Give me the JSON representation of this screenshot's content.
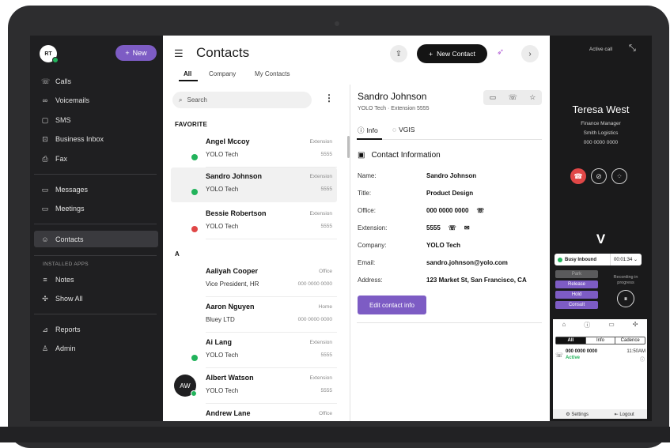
{
  "sidebar": {
    "avatar": "RT",
    "new_label": "New",
    "items": [
      {
        "label": "Calls",
        "icon": "phone-icon"
      },
      {
        "label": "Voicemails",
        "icon": "voicemail-icon"
      },
      {
        "label": "SMS",
        "icon": "sms-icon"
      },
      {
        "label": "Business Inbox",
        "icon": "inbox-icon"
      },
      {
        "label": "Fax",
        "icon": "fax-icon"
      },
      {
        "label": "Messages",
        "icon": "messages-icon"
      },
      {
        "label": "Meetings",
        "icon": "video-icon"
      },
      {
        "label": "Contacts",
        "icon": "contacts-icon"
      }
    ],
    "installed_caption": "INSTALLED APPS",
    "apps": [
      {
        "label": "Notes",
        "icon": "notes-icon"
      },
      {
        "label": "Show All",
        "icon": "puzzle-icon"
      }
    ],
    "bottom": [
      {
        "label": "Reports",
        "icon": "reports-icon"
      },
      {
        "label": "Admin",
        "icon": "admin-icon"
      }
    ]
  },
  "header": {
    "title": "Contacts",
    "tabs": [
      "All",
      "Company",
      "My Contacts"
    ],
    "new_contact_label": "New Contact"
  },
  "list": {
    "search_placeholder": "Search",
    "sections": [
      "FAVORITE",
      "A"
    ],
    "contacts": [
      {
        "name": "Angel Mccoy",
        "company": "YOLO Tech",
        "type": "Extension",
        "ext": "5555",
        "status": "online"
      },
      {
        "name": "Sandro Johnson",
        "company": "YOLO Tech",
        "type": "Extension",
        "ext": "5555",
        "status": "online"
      },
      {
        "name": "Bessie Robertson",
        "company": "YOLO Tech",
        "type": "Extension",
        "ext": "5555",
        "status": "busy"
      },
      {
        "name": "Aaliyah Cooper",
        "company": "Vice President, HR",
        "type": "Office",
        "ext": "000 0000 0000",
        "status": "none"
      },
      {
        "name": "Aaron Nguyen",
        "company": "Bluey LTD",
        "type": "Home",
        "ext": "000 0000 0000",
        "status": "none"
      },
      {
        "name": "Ai Lang",
        "company": "YOLO Tech",
        "type": "Extension",
        "ext": "5555",
        "status": "online"
      },
      {
        "name": "Albert Watson",
        "company": "YOLO Tech",
        "type": "Extension",
        "ext": "5555",
        "status": "online",
        "initials": "AW"
      },
      {
        "name": "Andrew Lane",
        "company": "",
        "type": "Office",
        "ext": "",
        "status": "none"
      }
    ]
  },
  "details": {
    "name": "Sandro Johnson",
    "subtitle": "YOLO Tech · Extension 5555",
    "tabs": [
      "Info",
      "VGIS"
    ],
    "section_title": "Contact Information",
    "fields": [
      {
        "label": "Name:",
        "value": "Sandro Johnson"
      },
      {
        "label": "Title:",
        "value": "Product Design"
      },
      {
        "label": "Office:",
        "value": "000 0000 0000"
      },
      {
        "label": "Extension:",
        "value": "5555"
      },
      {
        "label": "Company:",
        "value": "YOLO Tech"
      },
      {
        "label": "Email:",
        "value": "sandro.johnson@yolo.com"
      },
      {
        "label": "Address:",
        "value": "123 Market St, San Francisco, CA"
      }
    ],
    "edit_label": "Edit contact info"
  },
  "call": {
    "header": "Active call",
    "caller": "Teresa West",
    "role": "Finance Manager",
    "company": "Smith Logistics",
    "number": "000 0000 0000",
    "brand": "V",
    "status": "Busy Inbound",
    "timer": "00:01:34",
    "controls": [
      "Park",
      "Release",
      "Hold",
      "Consult"
    ],
    "recording": "Recording in progress",
    "filters": [
      "All",
      "Info",
      "Cadence"
    ],
    "log_number": "000 0000 0000",
    "log_state": "Active",
    "log_time": "11:50AM",
    "footer_settings": "Settings",
    "footer_logout": "Logout"
  },
  "colors": {
    "accent": "#7d5cc4",
    "online": "#22b35b",
    "busy": "#e04747",
    "sidebar": "#1f1f21"
  }
}
